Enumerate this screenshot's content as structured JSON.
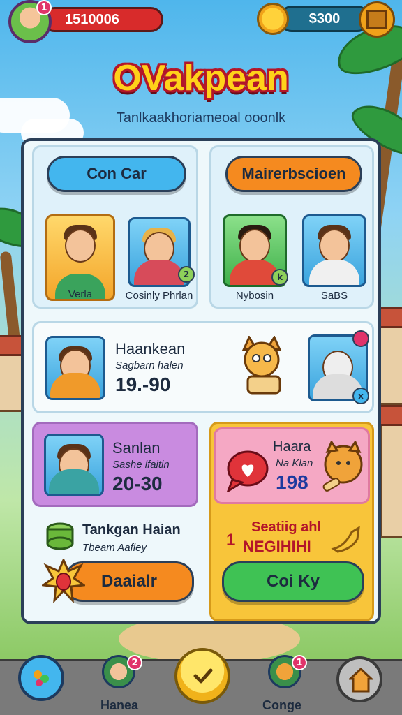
{
  "hud": {
    "coins": "1510006",
    "cash": "$300",
    "avatar_badge": "1",
    "title": "OVakpean",
    "subtitle": "Tanlkaakhoriameoal ooonlk"
  },
  "top_cards": {
    "left_button": "Con Car",
    "right_button": "Mairerbscioen",
    "left": [
      {
        "label": "Verla",
        "badge": ""
      },
      {
        "label": "Cosinly Phrlan",
        "badge": "2"
      }
    ],
    "right": [
      {
        "label": "Nybosin",
        "badge": "k"
      },
      {
        "label": "SaBS",
        "badge": ""
      }
    ]
  },
  "middle_card": {
    "name": "Haankean",
    "line": "Sagbarn halen",
    "score": "19.-90",
    "bot_badge": "x"
  },
  "lower_left": {
    "name": "Sanlan",
    "line": "Sashe lfaitin",
    "score": "20-30"
  },
  "lower_right": {
    "name": "Haara",
    "line": "Na Klan",
    "score": "198"
  },
  "bottom_left": {
    "title": "Tankgan Haian",
    "subtitle": "Tbeam Aafley",
    "button": "Daaialr"
  },
  "bottom_right": {
    "line1": "Seatiig ahl",
    "line2": "NEGIHIHI",
    "prefix": "1",
    "button": "Coi Ky"
  },
  "nav": {
    "left_label": "Hanea",
    "right_label": "Conge",
    "left_badge": "2",
    "right_badge": "1"
  },
  "colors": {
    "accent_blue": "#2fa6e8",
    "accent_orange": "#f58a1f",
    "accent_green": "#3fc254",
    "card_pink": "#f5a8c4",
    "card_purple": "#c98be0",
    "card_yellow": "#f8c53a"
  }
}
